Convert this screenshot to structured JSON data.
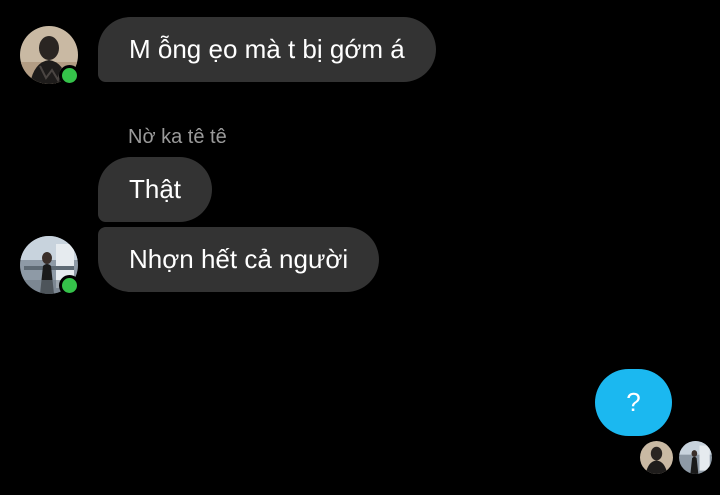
{
  "colors": {
    "background": "#000000",
    "incoming_bubble": "#333333",
    "outgoing_bubble": "#1bb8f0",
    "online_indicator": "#35c24a",
    "text": "#ffffff",
    "sender_name": "#9a9a9a"
  },
  "conversation": {
    "messages": [
      {
        "text": "M ỗng ẹo mà t bị gớm á"
      },
      {
        "sender": "Nờ ka tê tê",
        "text": "Thật"
      },
      {
        "text": "Nhợn hết cả người"
      }
    ],
    "outgoing": {
      "text": "?"
    }
  },
  "icons": {
    "avatar_1": "user-avatar-icon",
    "avatar_2": "user-avatar-icon",
    "online": "online-status-icon",
    "seen_1": "seen-receipt-avatar-icon",
    "seen_2": "seen-receipt-avatar-icon"
  }
}
